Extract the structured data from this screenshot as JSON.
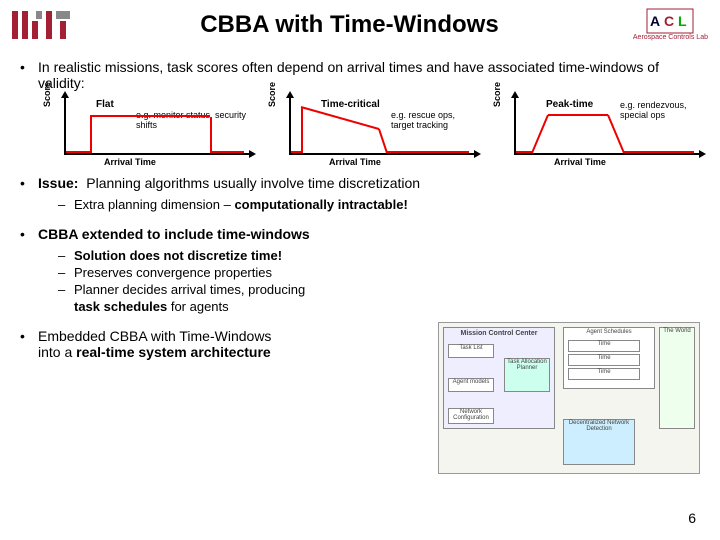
{
  "header": {
    "title": "CBBA with Time-Windows",
    "acl_label": "Aerospace Controls Lab",
    "acl_short": "ACL"
  },
  "bullets": {
    "b1": "In realistic missions, task scores often depend on arrival times and have associated time-windows of validity:",
    "issue_label": "Issue:",
    "issue_text": "Planning algorithms usually involve time discretization",
    "issue_sub1a": "Extra planning dimension – ",
    "issue_sub1b": "computationally intractable!",
    "ext_label": "CBBA extended to include time-windows",
    "ext_s1": "Solution does not discretize time!",
    "ext_s2": "Preserves convergence properties",
    "ext_s3a": "Planner decides arrival times, producing",
    "ext_s3b": "task schedules",
    "ext_s3c": " for agents",
    "emb1": "Embedded CBBA with Time-Windows",
    "emb2": "into a ",
    "emb3": "real-time system architecture"
  },
  "chart_data": [
    {
      "type": "line",
      "name": "Flat",
      "example": "e.g. monitor status, security shifts",
      "xlabel": "Arrival Time",
      "ylabel": "Score",
      "x": [
        0,
        0.15,
        0.15,
        0.85,
        0.85,
        1.0
      ],
      "y": [
        0,
        0,
        0.7,
        0.7,
        0,
        0
      ]
    },
    {
      "type": "line",
      "name": "Time-critical",
      "example": "e.g. rescue ops, target tracking",
      "xlabel": "Arrival Time",
      "ylabel": "Score",
      "x": [
        0,
        0.06,
        0.06,
        0.5,
        0.55,
        1.0
      ],
      "y": [
        0,
        0,
        0.9,
        0.5,
        0,
        0
      ]
    },
    {
      "type": "line",
      "name": "Peak-time",
      "example": "e.g. rendezvous, special ops",
      "xlabel": "Arrival Time",
      "ylabel": "Score",
      "x": [
        0,
        0.1,
        0.2,
        0.55,
        0.65,
        1.0
      ],
      "y": [
        0,
        0,
        0.75,
        0.75,
        0,
        0
      ]
    }
  ],
  "diagram": {
    "mcc": "Mission Control Center",
    "tasklist": "Task List",
    "am": "Agent models",
    "nc": "Network Configuration",
    "tap": "Task Allocation Planner",
    "as": "Agent Schedules",
    "dnd": "Decentralized Network Detection",
    "world": "The World",
    "time": "Time"
  },
  "pagenum": "6"
}
